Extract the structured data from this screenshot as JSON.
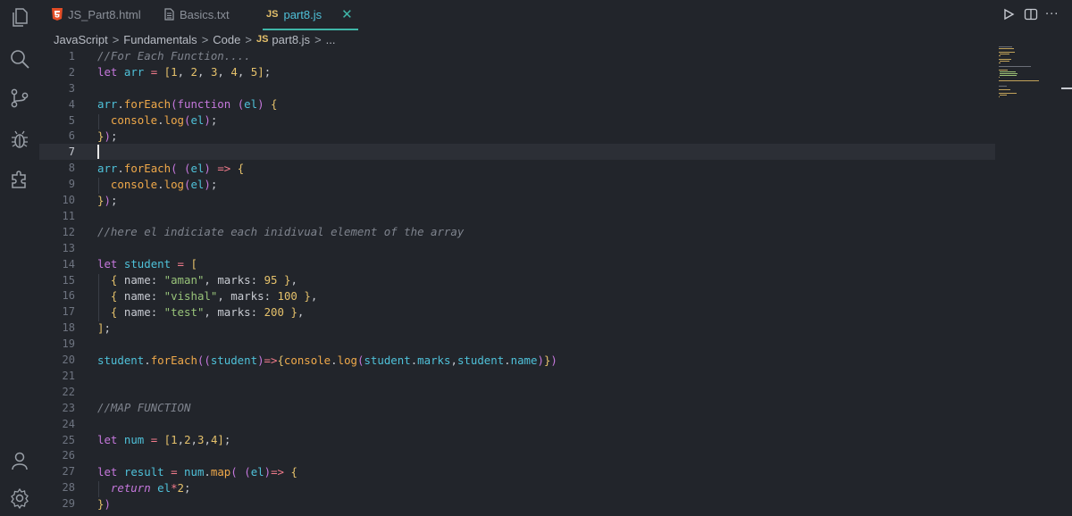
{
  "tabs": [
    {
      "icon": "html5-icon",
      "label": "JS_Part8.html",
      "active": false
    },
    {
      "icon": "text-file-icon",
      "label": "Basics.txt",
      "active": false
    },
    {
      "icon_text": "JS",
      "label": "part8.js",
      "active": true
    }
  ],
  "tab_close_glyph": "✕",
  "breadcrumb": {
    "items": [
      "JavaScript",
      "Fundamentals",
      "Code"
    ],
    "file_badge": "JS",
    "file": "part8.js",
    "tail": "..."
  },
  "sep": ">",
  "more_glyph": "···",
  "current_line": 7,
  "colors": {
    "keyword": "#c678dd",
    "variable": "#4fc1d9",
    "function": "#f0a94a",
    "comment": "#7f848e",
    "number": "#e5c16b",
    "string": "#98c379",
    "operator": "#f47c8c",
    "bracket": "#e5c16b"
  },
  "code_lines": [
    "//For Each Function....",
    "let arr = [1, 2, 3, 4, 5];",
    "",
    "arr.forEach(function (el) {",
    "  console.log(el);",
    "});",
    "",
    "arr.forEach( (el) => {",
    "  console.log(el);",
    "});",
    "",
    "//here el indiciate each inidivual element of the array",
    "",
    "let student = [",
    "  { name: \"aman\", marks: 95 },",
    "  { name: \"vishal\", marks: 100 },",
    "  { name: \"test\", marks: 200 },",
    "];",
    "",
    "student.forEach((student)=>{console.log(student.marks,student.name)})",
    "",
    "",
    "//MAP FUNCTION",
    "",
    "let num = [1,2,3,4];",
    "",
    "let result = num.map( (el)=> {",
    "  return el*2;",
    "})"
  ]
}
